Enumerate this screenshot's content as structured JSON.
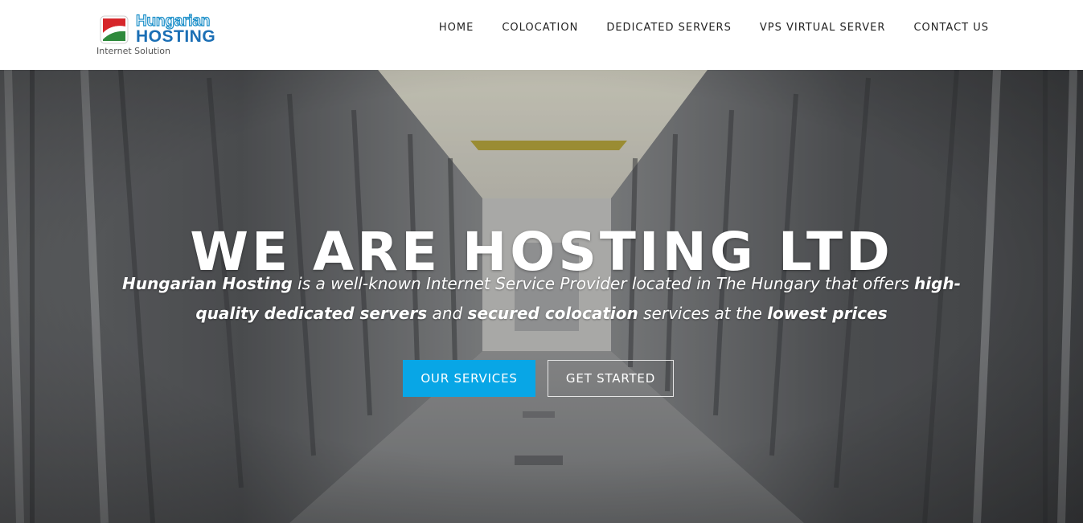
{
  "logo": {
    "line1": "Hungarian",
    "line2": "HOSTING",
    "tagline": "Internet Solution"
  },
  "nav": {
    "items": [
      {
        "label": "HOME"
      },
      {
        "label": "COLOCATION"
      },
      {
        "label": "DEDICATED SERVERS"
      },
      {
        "label": "VPS VIRTUAL SERVER"
      },
      {
        "label": "CONTACT US"
      }
    ]
  },
  "hero": {
    "title": "WE ARE HOSTING LTD",
    "sub": {
      "p1": "Hungarian Hosting",
      "p2": " is a well-known Internet Service Provider located in The Hungary that offers ",
      "p3": "high-quality dedicated servers",
      "p4": " and ",
      "p5": "secured colocation",
      "p6": " services at the ",
      "p7": "lowest prices"
    },
    "buttons": {
      "services": "OUR SERVICES",
      "started": "GET STARTED"
    }
  },
  "colors": {
    "accent": "#08a6e6",
    "logo_blue": "#1b6fb5",
    "flag_red": "#d6262a",
    "flag_green": "#2f8a3c"
  }
}
